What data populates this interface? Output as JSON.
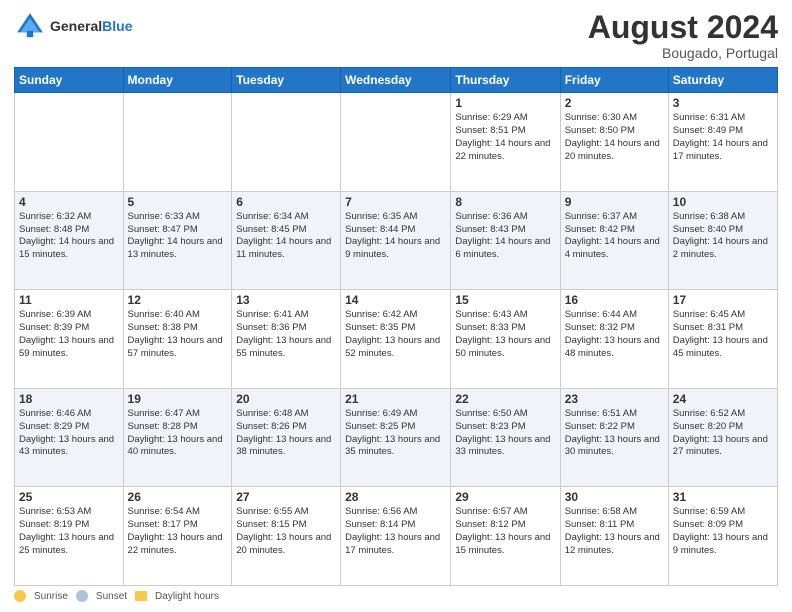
{
  "logo": {
    "line1": "General",
    "line2": "Blue"
  },
  "title": "August 2024",
  "subtitle": "Bougado, Portugal",
  "days_of_week": [
    "Sunday",
    "Monday",
    "Tuesday",
    "Wednesday",
    "Thursday",
    "Friday",
    "Saturday"
  ],
  "legend": {
    "sunrise_label": "Sunrise",
    "sunset_label": "Sunset",
    "daylight_label": "Daylight hours"
  },
  "weeks": [
    {
      "days": [
        {
          "num": "",
          "info": ""
        },
        {
          "num": "",
          "info": ""
        },
        {
          "num": "",
          "info": ""
        },
        {
          "num": "",
          "info": ""
        },
        {
          "num": "1",
          "info": "Sunrise: 6:29 AM\nSunset: 8:51 PM\nDaylight: 14 hours\nand 22 minutes."
        },
        {
          "num": "2",
          "info": "Sunrise: 6:30 AM\nSunset: 8:50 PM\nDaylight: 14 hours\nand 20 minutes."
        },
        {
          "num": "3",
          "info": "Sunrise: 6:31 AM\nSunset: 8:49 PM\nDaylight: 14 hours\nand 17 minutes."
        }
      ]
    },
    {
      "days": [
        {
          "num": "4",
          "info": "Sunrise: 6:32 AM\nSunset: 8:48 PM\nDaylight: 14 hours\nand 15 minutes."
        },
        {
          "num": "5",
          "info": "Sunrise: 6:33 AM\nSunset: 8:47 PM\nDaylight: 14 hours\nand 13 minutes."
        },
        {
          "num": "6",
          "info": "Sunrise: 6:34 AM\nSunset: 8:45 PM\nDaylight: 14 hours\nand 11 minutes."
        },
        {
          "num": "7",
          "info": "Sunrise: 6:35 AM\nSunset: 8:44 PM\nDaylight: 14 hours\nand 9 minutes."
        },
        {
          "num": "8",
          "info": "Sunrise: 6:36 AM\nSunset: 8:43 PM\nDaylight: 14 hours\nand 6 minutes."
        },
        {
          "num": "9",
          "info": "Sunrise: 6:37 AM\nSunset: 8:42 PM\nDaylight: 14 hours\nand 4 minutes."
        },
        {
          "num": "10",
          "info": "Sunrise: 6:38 AM\nSunset: 8:40 PM\nDaylight: 14 hours\nand 2 minutes."
        }
      ]
    },
    {
      "days": [
        {
          "num": "11",
          "info": "Sunrise: 6:39 AM\nSunset: 8:39 PM\nDaylight: 13 hours\nand 59 minutes."
        },
        {
          "num": "12",
          "info": "Sunrise: 6:40 AM\nSunset: 8:38 PM\nDaylight: 13 hours\nand 57 minutes."
        },
        {
          "num": "13",
          "info": "Sunrise: 6:41 AM\nSunset: 8:36 PM\nDaylight: 13 hours\nand 55 minutes."
        },
        {
          "num": "14",
          "info": "Sunrise: 6:42 AM\nSunset: 8:35 PM\nDaylight: 13 hours\nand 52 minutes."
        },
        {
          "num": "15",
          "info": "Sunrise: 6:43 AM\nSunset: 8:33 PM\nDaylight: 13 hours\nand 50 minutes."
        },
        {
          "num": "16",
          "info": "Sunrise: 6:44 AM\nSunset: 8:32 PM\nDaylight: 13 hours\nand 48 minutes."
        },
        {
          "num": "17",
          "info": "Sunrise: 6:45 AM\nSunset: 8:31 PM\nDaylight: 13 hours\nand 45 minutes."
        }
      ]
    },
    {
      "days": [
        {
          "num": "18",
          "info": "Sunrise: 6:46 AM\nSunset: 8:29 PM\nDaylight: 13 hours\nand 43 minutes."
        },
        {
          "num": "19",
          "info": "Sunrise: 6:47 AM\nSunset: 8:28 PM\nDaylight: 13 hours\nand 40 minutes."
        },
        {
          "num": "20",
          "info": "Sunrise: 6:48 AM\nSunset: 8:26 PM\nDaylight: 13 hours\nand 38 minutes."
        },
        {
          "num": "21",
          "info": "Sunrise: 6:49 AM\nSunset: 8:25 PM\nDaylight: 13 hours\nand 35 minutes."
        },
        {
          "num": "22",
          "info": "Sunrise: 6:50 AM\nSunset: 8:23 PM\nDaylight: 13 hours\nand 33 minutes."
        },
        {
          "num": "23",
          "info": "Sunrise: 6:51 AM\nSunset: 8:22 PM\nDaylight: 13 hours\nand 30 minutes."
        },
        {
          "num": "24",
          "info": "Sunrise: 6:52 AM\nSunset: 8:20 PM\nDaylight: 13 hours\nand 27 minutes."
        }
      ]
    },
    {
      "days": [
        {
          "num": "25",
          "info": "Sunrise: 6:53 AM\nSunset: 8:19 PM\nDaylight: 13 hours\nand 25 minutes."
        },
        {
          "num": "26",
          "info": "Sunrise: 6:54 AM\nSunset: 8:17 PM\nDaylight: 13 hours\nand 22 minutes."
        },
        {
          "num": "27",
          "info": "Sunrise: 6:55 AM\nSunset: 8:15 PM\nDaylight: 13 hours\nand 20 minutes."
        },
        {
          "num": "28",
          "info": "Sunrise: 6:56 AM\nSunset: 8:14 PM\nDaylight: 13 hours\nand 17 minutes."
        },
        {
          "num": "29",
          "info": "Sunrise: 6:57 AM\nSunset: 8:12 PM\nDaylight: 13 hours\nand 15 minutes."
        },
        {
          "num": "30",
          "info": "Sunrise: 6:58 AM\nSunset: 8:11 PM\nDaylight: 13 hours\nand 12 minutes."
        },
        {
          "num": "31",
          "info": "Sunrise: 6:59 AM\nSunset: 8:09 PM\nDaylight: 13 hours\nand 9 minutes."
        }
      ]
    }
  ]
}
